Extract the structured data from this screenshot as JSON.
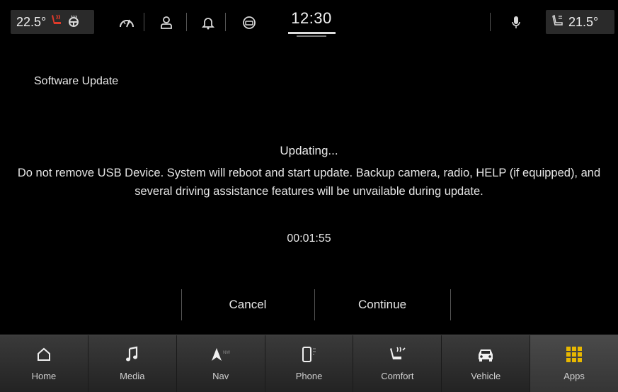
{
  "status_bar": {
    "left_temp": "22.5°",
    "right_temp": "21.5°",
    "clock": "12:30",
    "icons": [
      "heated-seat-icon",
      "heated-steering-icon",
      "driver-assist-icon",
      "user-profile-icon",
      "notification-bell-icon",
      "vehicle-sensor-icon",
      "microphone-icon",
      "seat-fan-icon"
    ]
  },
  "main": {
    "title": "Software Update",
    "status": "Updating...",
    "message": "Do not remove USB Device. System will reboot and start update. Backup camera, radio, HELP (if equipped), and several driving assistance features will be unvailable during update.",
    "timer": "00:01:55",
    "buttons": {
      "cancel": "Cancel",
      "continue": "Continue"
    }
  },
  "nav": {
    "items": [
      {
        "label": "Home",
        "icon": "home-icon"
      },
      {
        "label": "Media",
        "icon": "music-note-icon"
      },
      {
        "label": "Nav",
        "icon": "compass-icon"
      },
      {
        "label": "Phone",
        "icon": "phone-icon"
      },
      {
        "label": "Comfort",
        "icon": "seat-comfort-icon"
      },
      {
        "label": "Vehicle",
        "icon": "car-icon"
      },
      {
        "label": "Apps",
        "icon": "apps-grid-icon"
      }
    ],
    "active": "Apps"
  },
  "colors": {
    "background": "#000000",
    "nav_bar": "#2e2e2e",
    "heated_seat": "#e03a2a",
    "apps_icon": "#e8b800"
  }
}
